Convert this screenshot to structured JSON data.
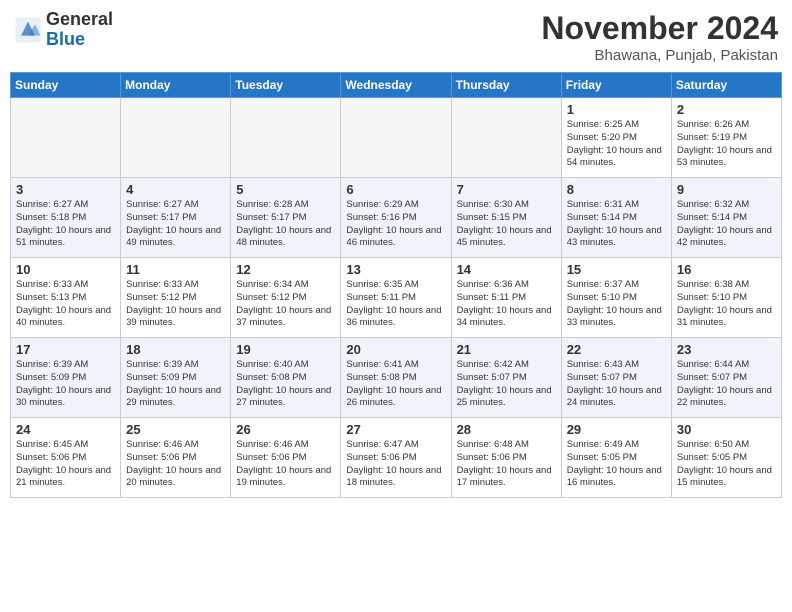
{
  "header": {
    "logo_general": "General",
    "logo_blue": "Blue",
    "month_title": "November 2024",
    "location": "Bhawana, Punjab, Pakistan"
  },
  "days_of_week": [
    "Sunday",
    "Monday",
    "Tuesday",
    "Wednesday",
    "Thursday",
    "Friday",
    "Saturday"
  ],
  "weeks": [
    [
      {
        "day": "",
        "info": ""
      },
      {
        "day": "",
        "info": ""
      },
      {
        "day": "",
        "info": ""
      },
      {
        "day": "",
        "info": ""
      },
      {
        "day": "",
        "info": ""
      },
      {
        "day": "1",
        "info": "Sunrise: 6:25 AM\nSunset: 5:20 PM\nDaylight: 10 hours and 54 minutes."
      },
      {
        "day": "2",
        "info": "Sunrise: 6:26 AM\nSunset: 5:19 PM\nDaylight: 10 hours and 53 minutes."
      }
    ],
    [
      {
        "day": "3",
        "info": "Sunrise: 6:27 AM\nSunset: 5:18 PM\nDaylight: 10 hours and 51 minutes."
      },
      {
        "day": "4",
        "info": "Sunrise: 6:27 AM\nSunset: 5:17 PM\nDaylight: 10 hours and 49 minutes."
      },
      {
        "day": "5",
        "info": "Sunrise: 6:28 AM\nSunset: 5:17 PM\nDaylight: 10 hours and 48 minutes."
      },
      {
        "day": "6",
        "info": "Sunrise: 6:29 AM\nSunset: 5:16 PM\nDaylight: 10 hours and 46 minutes."
      },
      {
        "day": "7",
        "info": "Sunrise: 6:30 AM\nSunset: 5:15 PM\nDaylight: 10 hours and 45 minutes."
      },
      {
        "day": "8",
        "info": "Sunrise: 6:31 AM\nSunset: 5:14 PM\nDaylight: 10 hours and 43 minutes."
      },
      {
        "day": "9",
        "info": "Sunrise: 6:32 AM\nSunset: 5:14 PM\nDaylight: 10 hours and 42 minutes."
      }
    ],
    [
      {
        "day": "10",
        "info": "Sunrise: 6:33 AM\nSunset: 5:13 PM\nDaylight: 10 hours and 40 minutes."
      },
      {
        "day": "11",
        "info": "Sunrise: 6:33 AM\nSunset: 5:12 PM\nDaylight: 10 hours and 39 minutes."
      },
      {
        "day": "12",
        "info": "Sunrise: 6:34 AM\nSunset: 5:12 PM\nDaylight: 10 hours and 37 minutes."
      },
      {
        "day": "13",
        "info": "Sunrise: 6:35 AM\nSunset: 5:11 PM\nDaylight: 10 hours and 36 minutes."
      },
      {
        "day": "14",
        "info": "Sunrise: 6:36 AM\nSunset: 5:11 PM\nDaylight: 10 hours and 34 minutes."
      },
      {
        "day": "15",
        "info": "Sunrise: 6:37 AM\nSunset: 5:10 PM\nDaylight: 10 hours and 33 minutes."
      },
      {
        "day": "16",
        "info": "Sunrise: 6:38 AM\nSunset: 5:10 PM\nDaylight: 10 hours and 31 minutes."
      }
    ],
    [
      {
        "day": "17",
        "info": "Sunrise: 6:39 AM\nSunset: 5:09 PM\nDaylight: 10 hours and 30 minutes."
      },
      {
        "day": "18",
        "info": "Sunrise: 6:39 AM\nSunset: 5:09 PM\nDaylight: 10 hours and 29 minutes."
      },
      {
        "day": "19",
        "info": "Sunrise: 6:40 AM\nSunset: 5:08 PM\nDaylight: 10 hours and 27 minutes."
      },
      {
        "day": "20",
        "info": "Sunrise: 6:41 AM\nSunset: 5:08 PM\nDaylight: 10 hours and 26 minutes."
      },
      {
        "day": "21",
        "info": "Sunrise: 6:42 AM\nSunset: 5:07 PM\nDaylight: 10 hours and 25 minutes."
      },
      {
        "day": "22",
        "info": "Sunrise: 6:43 AM\nSunset: 5:07 PM\nDaylight: 10 hours and 24 minutes."
      },
      {
        "day": "23",
        "info": "Sunrise: 6:44 AM\nSunset: 5:07 PM\nDaylight: 10 hours and 22 minutes."
      }
    ],
    [
      {
        "day": "24",
        "info": "Sunrise: 6:45 AM\nSunset: 5:06 PM\nDaylight: 10 hours and 21 minutes."
      },
      {
        "day": "25",
        "info": "Sunrise: 6:46 AM\nSunset: 5:06 PM\nDaylight: 10 hours and 20 minutes."
      },
      {
        "day": "26",
        "info": "Sunrise: 6:46 AM\nSunset: 5:06 PM\nDaylight: 10 hours and 19 minutes."
      },
      {
        "day": "27",
        "info": "Sunrise: 6:47 AM\nSunset: 5:06 PM\nDaylight: 10 hours and 18 minutes."
      },
      {
        "day": "28",
        "info": "Sunrise: 6:48 AM\nSunset: 5:06 PM\nDaylight: 10 hours and 17 minutes."
      },
      {
        "day": "29",
        "info": "Sunrise: 6:49 AM\nSunset: 5:05 PM\nDaylight: 10 hours and 16 minutes."
      },
      {
        "day": "30",
        "info": "Sunrise: 6:50 AM\nSunset: 5:05 PM\nDaylight: 10 hours and 15 minutes."
      }
    ]
  ]
}
